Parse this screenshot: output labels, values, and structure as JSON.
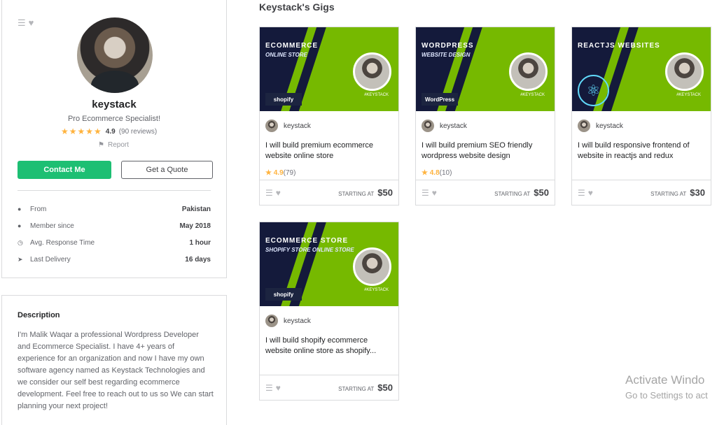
{
  "profile": {
    "name": "keystack",
    "tagline": "Pro Ecommerce Specialist!",
    "rating": "4.9",
    "reviews": "(90 reviews)",
    "report": "Report",
    "contact_button": "Contact Me",
    "quote_button": "Get a Quote",
    "stats": [
      {
        "label": "From",
        "value": "Pakistan",
        "icon": "location-icon"
      },
      {
        "label": "Member since",
        "value": "May 2018",
        "icon": "user-icon"
      },
      {
        "label": "Avg. Response Time",
        "value": "1 hour",
        "icon": "clock-icon"
      },
      {
        "label": "Last Delivery",
        "value": "16 days",
        "icon": "send-icon"
      }
    ]
  },
  "description": {
    "title": "Description",
    "text": "I'm Malik Waqar a professional Wordpress Developer and Ecommerce Specialist. I have 4+ years of experience for an organization and now I have my own software agency named as Keystack Technologies and we consider our self best regarding ecommerce development. Feel free to reach out to us so We can start planning your next project!"
  },
  "gigs_title": "Keystack's Gigs",
  "gigs": [
    {
      "thumb_line1": "ECOMMERCE",
      "thumb_line2": "ONLINE STORE",
      "thumb_logo": "shopify",
      "thumb_tag": "#KEYSTACK",
      "seller": "keystack",
      "title": "I will build premium ecommerce website online store",
      "rating": "4.9",
      "reviews": "(79)",
      "price_label": "STARTING AT",
      "price": "$50"
    },
    {
      "thumb_line1": "WORDPRESS",
      "thumb_line2": "WEBSITE DESIGN",
      "thumb_logo": "WordPress",
      "thumb_tag": "#KEYSTACK",
      "seller": "keystack",
      "title": "I will build premium SEO friendly wordpress website design",
      "rating": "4.8",
      "reviews": "(10)",
      "price_label": "STARTING AT",
      "price": "$50"
    },
    {
      "thumb_line1": "REACTJS WEBSITES",
      "thumb_line2": "",
      "thumb_logo": "",
      "thumb_tag": "#KEYSTACK",
      "seller": "keystack",
      "title": "I will build responsive frontend of website in reactjs and redux",
      "rating": "",
      "reviews": "",
      "price_label": "STARTING AT",
      "price": "$30"
    },
    {
      "thumb_line1": "ECOMMERCE STORE",
      "thumb_line2": "SHOPIFY STORE ONLINE STORE",
      "thumb_logo": "shopify",
      "thumb_tag": "#KEYSTACK",
      "seller": "keystack",
      "title": "I will build shopify ecommerce website online store as shopify...",
      "rating": "",
      "reviews": "",
      "price_label": "STARTING AT",
      "price": "$50"
    }
  ],
  "watermark": {
    "line1": "Activate Windo",
    "line2": "Go to Settings to act"
  }
}
